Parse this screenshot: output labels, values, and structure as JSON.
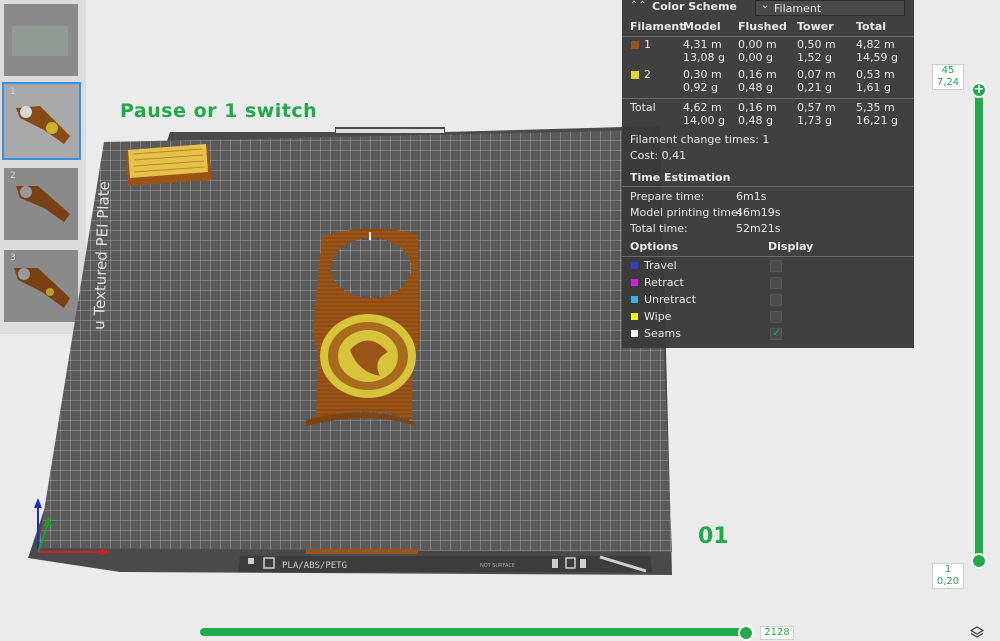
{
  "thumbnails": [
    {
      "num": "",
      "selected": false
    },
    {
      "num": "1",
      "selected": true
    },
    {
      "num": "2",
      "selected": false
    },
    {
      "num": "3",
      "selected": false
    }
  ],
  "pause_label": "Pause or 1 switch",
  "plate": {
    "side_text": "u Textured PEI Plate",
    "bottom_text": "PLA/ABS/PETG",
    "not_surface": "NOT SURFACE",
    "plate_number": "01"
  },
  "panel": {
    "color_scheme_label": "Color Scheme",
    "scheme_value": "Filament",
    "headers": {
      "filament": "Filament",
      "model": "Model",
      "flushed": "Flushed",
      "tower": "Tower",
      "total": "Total"
    },
    "rows": [
      {
        "id": "1",
        "color": "#9a5418",
        "model_m": "4,31 m",
        "model_g": "13,08 g",
        "flushed_m": "0,00 m",
        "flushed_g": "0,00 g",
        "tower_m": "0,50 m",
        "tower_g": "1,52 g",
        "total_m": "4,82 m",
        "total_g": "14,59 g"
      },
      {
        "id": "2",
        "color": "#e6d22a",
        "model_m": "0,30 m",
        "model_g": "0,92 g",
        "flushed_m": "0,16 m",
        "flushed_g": "0,48 g",
        "tower_m": "0,07 m",
        "tower_g": "0,21 g",
        "total_m": "0,53 m",
        "total_g": "1,61 g"
      }
    ],
    "total": {
      "label": "Total",
      "model_m": "4,62 m",
      "model_g": "14,00 g",
      "flushed_m": "0,16 m",
      "flushed_g": "0,48 g",
      "tower_m": "0,57 m",
      "tower_g": "1,73 g",
      "total_m": "5,35 m",
      "total_g": "16,21 g"
    },
    "filament_change": "Filament change times:  1",
    "cost": "Cost:  0,41",
    "time_estimation": "Time Estimation",
    "prepare_label": "Prepare time:",
    "prepare_value": "6m1s",
    "model_time_label": "Model printing time:",
    "model_time_value": "46m19s",
    "total_time_label": "Total time:",
    "total_time_value": "52m21s",
    "options_label": "Options",
    "display_label": "Display",
    "options": [
      {
        "label": "Travel",
        "color": "#3040c8",
        "checked": false
      },
      {
        "label": "Retract",
        "color": "#d020d0",
        "checked": false
      },
      {
        "label": "Unretract",
        "color": "#40b0e0",
        "checked": false
      },
      {
        "label": "Wipe",
        "color": "#f0f020",
        "checked": false
      },
      {
        "label": "Seams",
        "color": "#f0f0f0",
        "checked": true
      }
    ]
  },
  "layer_slider": {
    "top_layer": "45",
    "top_height": "7,24",
    "bottom_layer": "1",
    "bottom_height": "0,20"
  },
  "move_slider": {
    "value": "2128"
  },
  "colors": {
    "accent": "#22aa4a",
    "panel_bg": "#3a3a3a"
  }
}
